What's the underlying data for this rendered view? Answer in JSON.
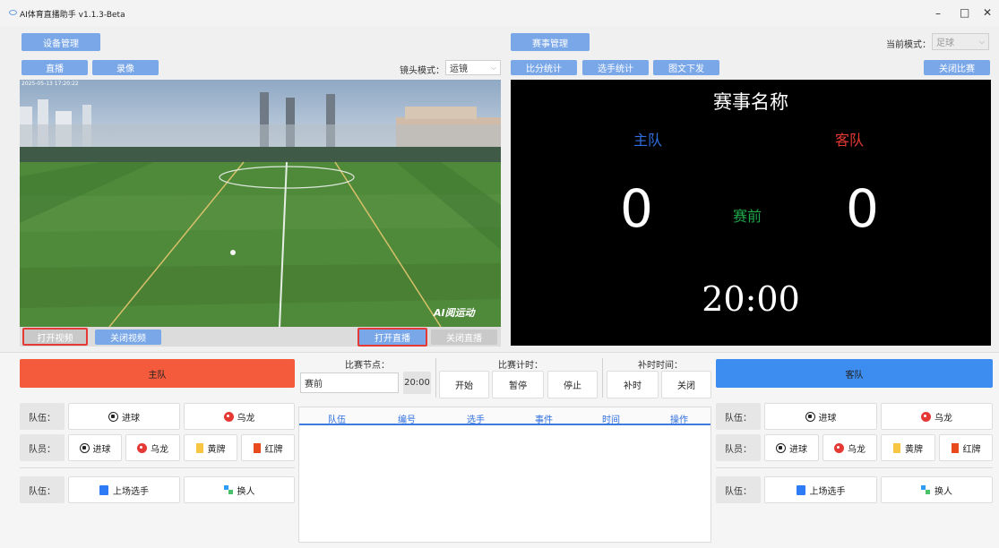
{
  "window": {
    "title": "AI体育直播助手 v1.1.3-Beta",
    "controls": [
      "–",
      "□",
      "✕"
    ]
  },
  "left_panel": {
    "device_btn": "设备管理",
    "tabs": [
      "直播",
      "录像"
    ],
    "lens_mode_label": "镜头模式：",
    "lens_mode_value": "运镜",
    "video_timestamp": "2025-05-13 17:20:22",
    "video_watermark": "AI阅运动",
    "open_video": "打开视频",
    "close_video": "关闭视频",
    "open_live": "打开直播",
    "close_live": "关闭直播"
  },
  "right_panel": {
    "match_btn": "赛事管理",
    "mode_label": "当前模式：",
    "mode_value": "足球",
    "tabs": [
      "比分统计",
      "选手统计",
      "图文下发"
    ],
    "close_match": "关闭比赛"
  },
  "scoreboard": {
    "match_name": "赛事名称",
    "home": "主队",
    "away": "客队",
    "home_score": "0",
    "away_score": "0",
    "phase": "赛前",
    "clock": "20:00",
    "colors": {
      "home": "#2f6fe0",
      "away": "#e53935",
      "phase": "#1fa54a"
    }
  },
  "control": {
    "home_team": "主队",
    "away_team": "客队",
    "node_label": "比赛节点：",
    "node_value": "赛前",
    "node_time": "20:00",
    "timer_label": "比赛计时：",
    "timer_buttons": [
      "开始",
      "暂停",
      "停止"
    ],
    "extra_label": "补时时间：",
    "extra_buttons": [
      "补时",
      "关闭"
    ],
    "team_label": "队伍：",
    "player_label": "队员：",
    "goal": "进球",
    "own_goal": "乌龙",
    "yellow": "黄牌",
    "red": "红牌",
    "starters": "上场选手",
    "substitute": "换人",
    "table_headers": [
      "队伍",
      "编号",
      "选手",
      "事件",
      "时间",
      "操作"
    ]
  }
}
